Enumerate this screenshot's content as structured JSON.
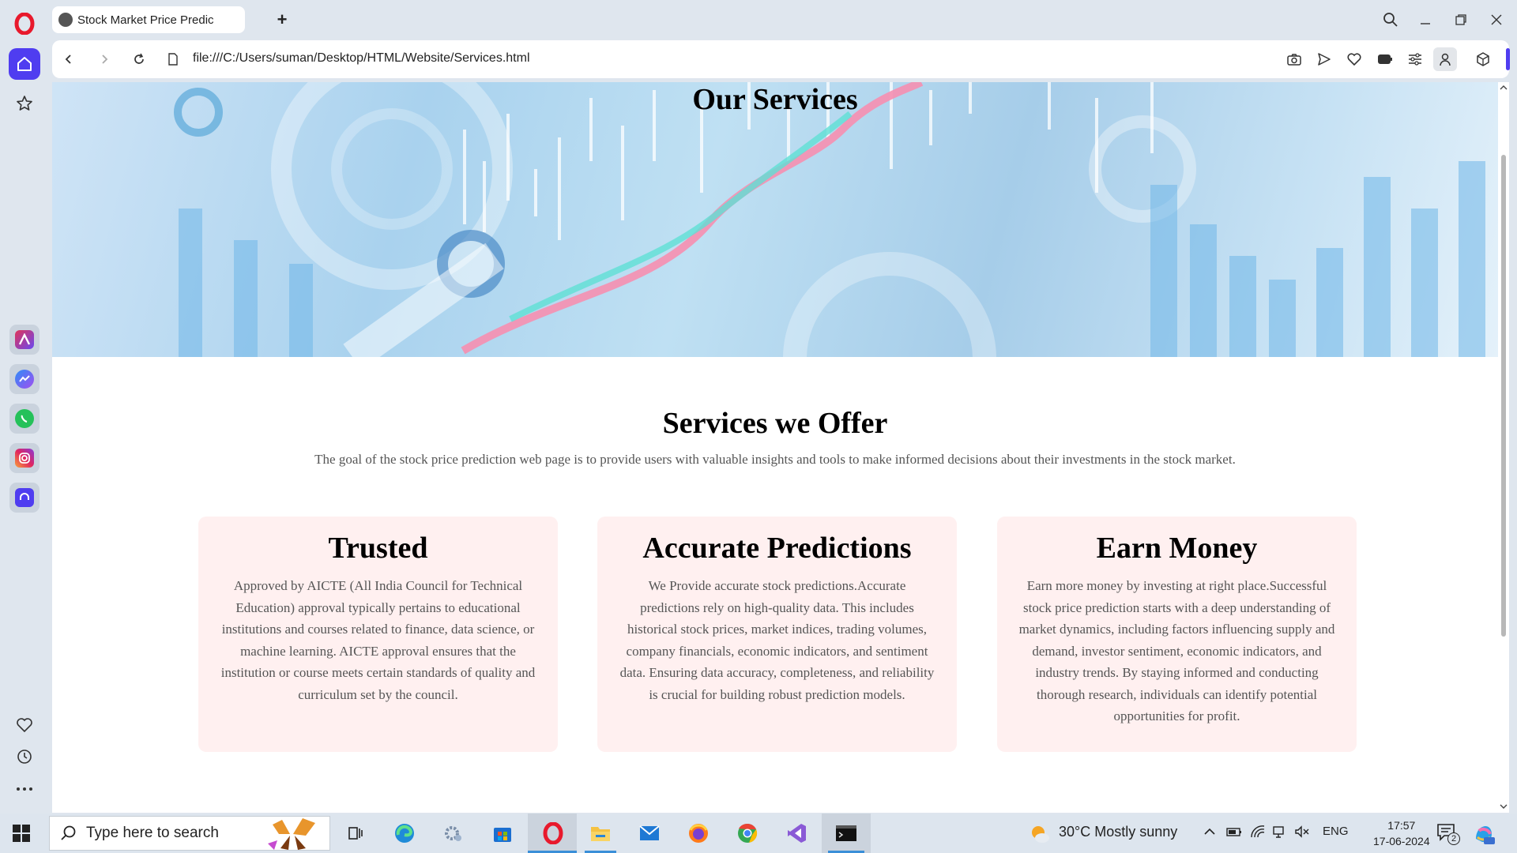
{
  "browser": {
    "tab_title": "Stock Market Price Predict",
    "url": "file:///C:/Users/suman/Desktop/HTML/Website/Services.html"
  },
  "sidebar": {
    "items": [
      "home-icon",
      "star-icon",
      "aria-icon",
      "messenger-icon",
      "whatsapp-icon",
      "instagram-icon",
      "player-icon",
      "heart-icon",
      "history-icon",
      "more-icon"
    ]
  },
  "page": {
    "hero_title": "Our Services",
    "section_title": "Services we Offer",
    "section_desc": "The goal of the stock price prediction web page is to provide users with valuable insights and tools to make informed decisions about their investments in the stock market.",
    "cards": [
      {
        "title": "Trusted",
        "text": "Approved by AICTE (All India Council for Technical Education) approval typically pertains to educational institutions and courses related to finance, data science, or machine learning. AICTE approval ensures that the institution or course meets certain standards of quality and curriculum set by the council."
      },
      {
        "title": "Accurate Predictions",
        "text": "We Provide accurate stock predictions.Accurate predictions rely on high-quality data. This includes historical stock prices, market indices, trading volumes, company financials, economic indicators, and sentiment data. Ensuring data accuracy, completeness, and reliability is crucial for building robust prediction models."
      },
      {
        "title": "Earn Money",
        "text": "Earn more money by investing at right place.Successful stock price prediction starts with a deep understanding of market dynamics, including factors influencing supply and demand, investor sentiment, economic indicators, and industry trends. By staying informed and conducting thorough research, individuals can identify potential opportunities for profit."
      }
    ]
  },
  "taskbar": {
    "search_placeholder": "Type here to search",
    "weather": "30°C  Mostly sunny",
    "language": "ENG",
    "time": "17:57",
    "date": "17-06-2024",
    "notifications": "2"
  },
  "colors": {
    "accent": "#4f3df0",
    "card_bg": "#fff0f0",
    "opera_red": "#e8192c"
  }
}
